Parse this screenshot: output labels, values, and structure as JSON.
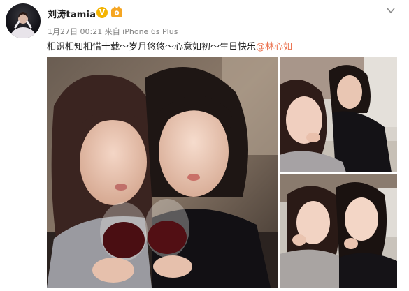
{
  "user": {
    "name": "刘涛tamia",
    "verified_badge": "V",
    "avatar_icon": "avatar-icon"
  },
  "post": {
    "meta": "1月27日 00:21 来自 iPhone 6s Plus",
    "text_main": "相识相知相惜十载～岁月悠悠～心意如初～生日快乐",
    "mention": "@林心如"
  },
  "colors": {
    "mention": "#eb7350",
    "verified": "#f4b400"
  },
  "icons": [
    "verified-badge-icon",
    "member-badge-icon",
    "chevron-down-icon"
  ]
}
